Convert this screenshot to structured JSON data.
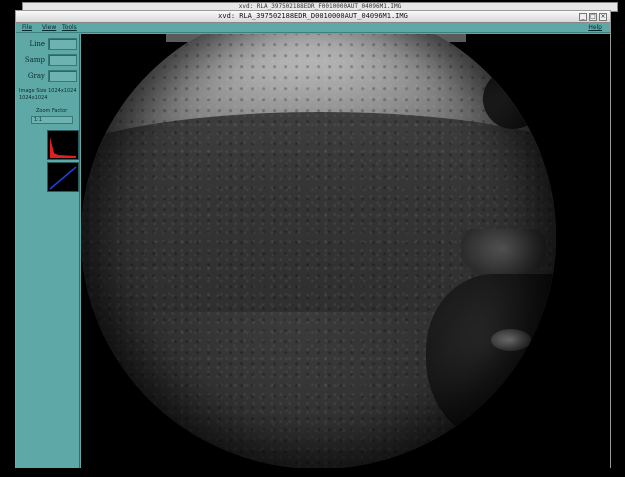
{
  "background_window": {
    "title": "xvd: RLA_397502188EDR_F0010000AUT_04096M1.IMG"
  },
  "window": {
    "title": "xvd: RLA_397502188EDR_D0010000AUT_04096M1.IMG",
    "buttons": [
      "_",
      "□",
      "×"
    ]
  },
  "menu": {
    "file": "File",
    "view": "View",
    "tools": "Tools",
    "help": "Help"
  },
  "panel": {
    "line_label": "Line",
    "samp_label": "Samp",
    "gray_label": "Gray",
    "image_size_label": "Image Size 1024x1024",
    "image_size_value": "1024x1024",
    "zoom_label": "Zoom Factor",
    "zoom_value": "1:1"
  }
}
